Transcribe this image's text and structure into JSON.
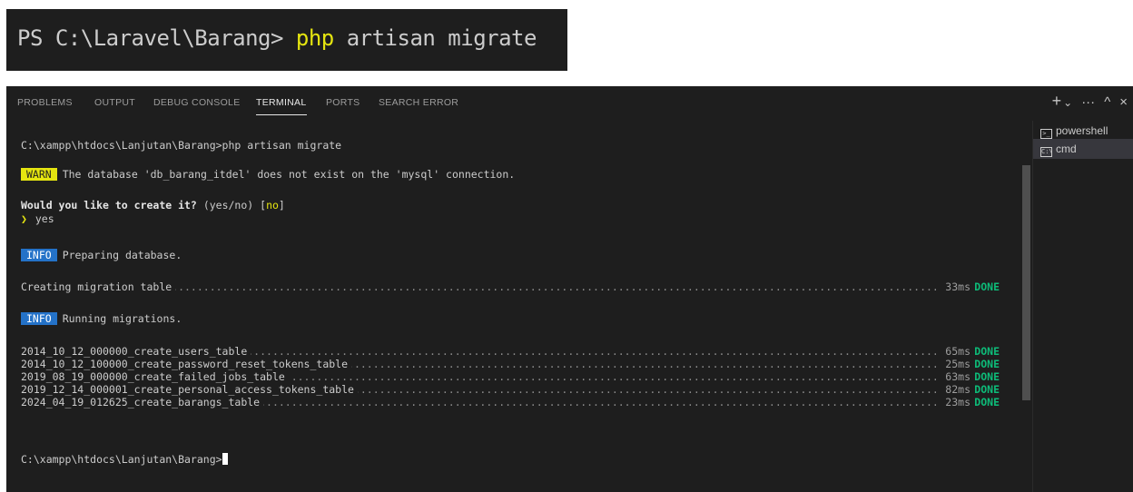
{
  "powershell_strip": {
    "prompt": "PS C:\\Laravel\\Barang>",
    "command": "php",
    "args": "artisan migrate"
  },
  "panel": {
    "tabs": [
      "PROBLEMS",
      "OUTPUT",
      "DEBUG CONSOLE",
      "TERMINAL",
      "PORTS",
      "SEARCH ERROR"
    ],
    "active_tab": "TERMINAL",
    "actions": {
      "new_terminal": "+",
      "dropdown": "⌄",
      "more": "···",
      "maximize": "^",
      "close": "×"
    }
  },
  "terminal": {
    "command_line": "C:\\xampp\\htdocs\\Lanjutan\\Barang>php artisan migrate",
    "warn_badge": "WARN",
    "warn_text": "The database 'db_barang_itdel' does not exist on the 'mysql' connection.",
    "question_bold": "Would you like to create it?",
    "question_rest": "(yes/no) [",
    "question_default": "no",
    "question_close": "]",
    "answer_arrow": "❯",
    "answer": "yes",
    "info1_badge": "INFO",
    "info1_text": "Preparing database.",
    "creating_table": {
      "name": "Creating migration table",
      "time": "33ms",
      "status": "DONE"
    },
    "info2_badge": "INFO",
    "info2_text": "Running migrations.",
    "migrations": [
      {
        "name": "2014_10_12_000000_create_users_table",
        "time": "65ms",
        "status": "DONE"
      },
      {
        "name": "2014_10_12_100000_create_password_reset_tokens_table",
        "time": "25ms",
        "status": "DONE"
      },
      {
        "name": "2019_08_19_000000_create_failed_jobs_table",
        "time": "63ms",
        "status": "DONE"
      },
      {
        "name": "2019_12_14_000001_create_personal_access_tokens_table",
        "time": "82ms",
        "status": "DONE"
      },
      {
        "name": "2024_04_19_012625_create_barangs_table",
        "time": "23ms",
        "status": "DONE"
      }
    ],
    "final_prompt": "C:\\xampp\\htdocs\\Lanjutan\\Barang>"
  },
  "terminal_list": [
    {
      "label": "powershell",
      "icon": "powershell-icon",
      "selected": false
    },
    {
      "label": "cmd",
      "icon": "cmd-icon",
      "selected": true
    }
  ]
}
